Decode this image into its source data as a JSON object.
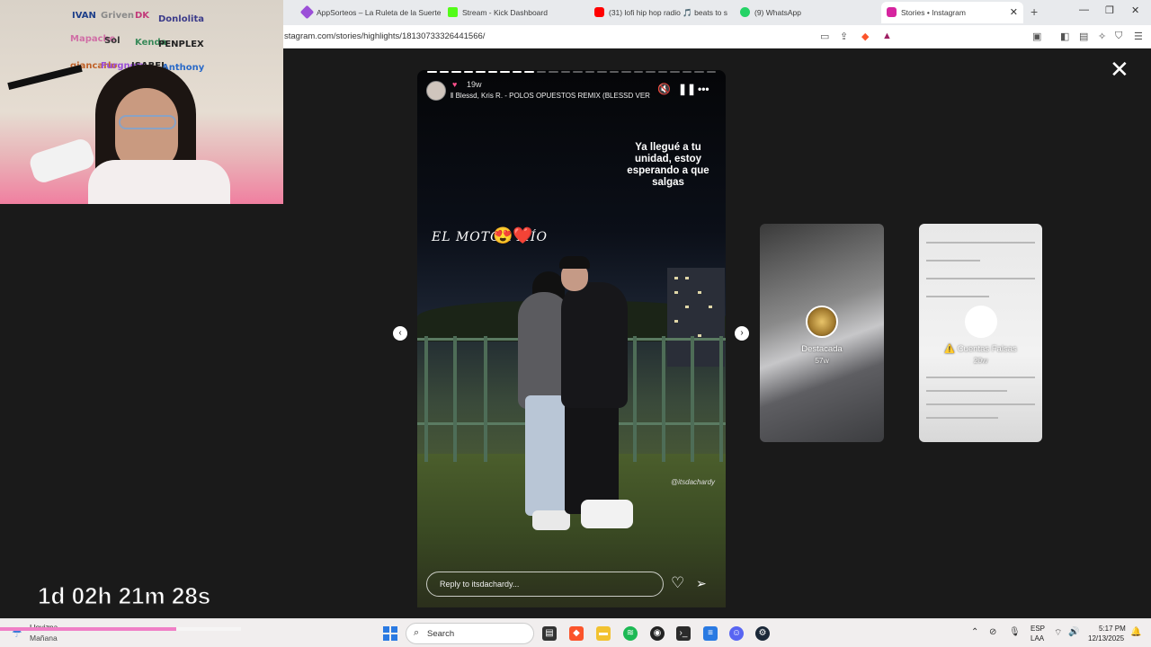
{
  "browser": {
    "tabs": [
      {
        "label": "AppSorteos – La Ruleta de la Suerte",
        "icon": "appsorteos-icon",
        "color": "#9b4fd8"
      },
      {
        "label": "Stream - Kick Dashboard",
        "icon": "kick-icon",
        "color": "#53fc18",
        "muted": true
      },
      {
        "label": "(31) lofi hip hop radio 🎵 beats to s",
        "icon": "youtube-icon",
        "color": "#ff0000"
      },
      {
        "label": "(9) WhatsApp",
        "icon": "whatsapp-icon",
        "color": "#25d366"
      },
      {
        "label": "Stories • Instagram",
        "icon": "instagram-icon",
        "color": "#d6249f",
        "active": true
      }
    ],
    "url": "stagram.com/stories/highlights/18130733326441566/"
  },
  "story": {
    "time": "19w",
    "music": "Blessd, Kris R. - POLOS OPUESTOS REMIX (BLESSD VERSION",
    "caption": "Ya llegué a tu unidad, estoy esperando a que salgas",
    "handwritten": "EL MOTOR MÍO",
    "stickers": "😍❤️",
    "watermark": "@itsdachardy",
    "reply_placeholder": "Reply to itsdachardy...",
    "progress": {
      "total": 24,
      "done": 9
    }
  },
  "highlights": [
    {
      "title": "Destacada",
      "age": "57w"
    },
    {
      "title": "⚠️ Cuentas Falsas",
      "age": "20w"
    }
  ],
  "overlay": {
    "countdown": "1d 02h 21m 28s",
    "webcam_names": [
      "IVAN",
      "Griven",
      "DK",
      "Donlolita",
      "Mapache",
      "Sol",
      "Kenda",
      "PENPLEX",
      "giancarlo",
      "Furgnery",
      "ISABEL",
      "Anthony"
    ]
  },
  "taskbar": {
    "weather": "Llovizna",
    "weather_sub": "Mañana",
    "search_label": "Search",
    "lang_a": "ESP",
    "lang_b": "LAA",
    "clock_time": "5:17 PM",
    "clock_date": "12/13/2025"
  }
}
